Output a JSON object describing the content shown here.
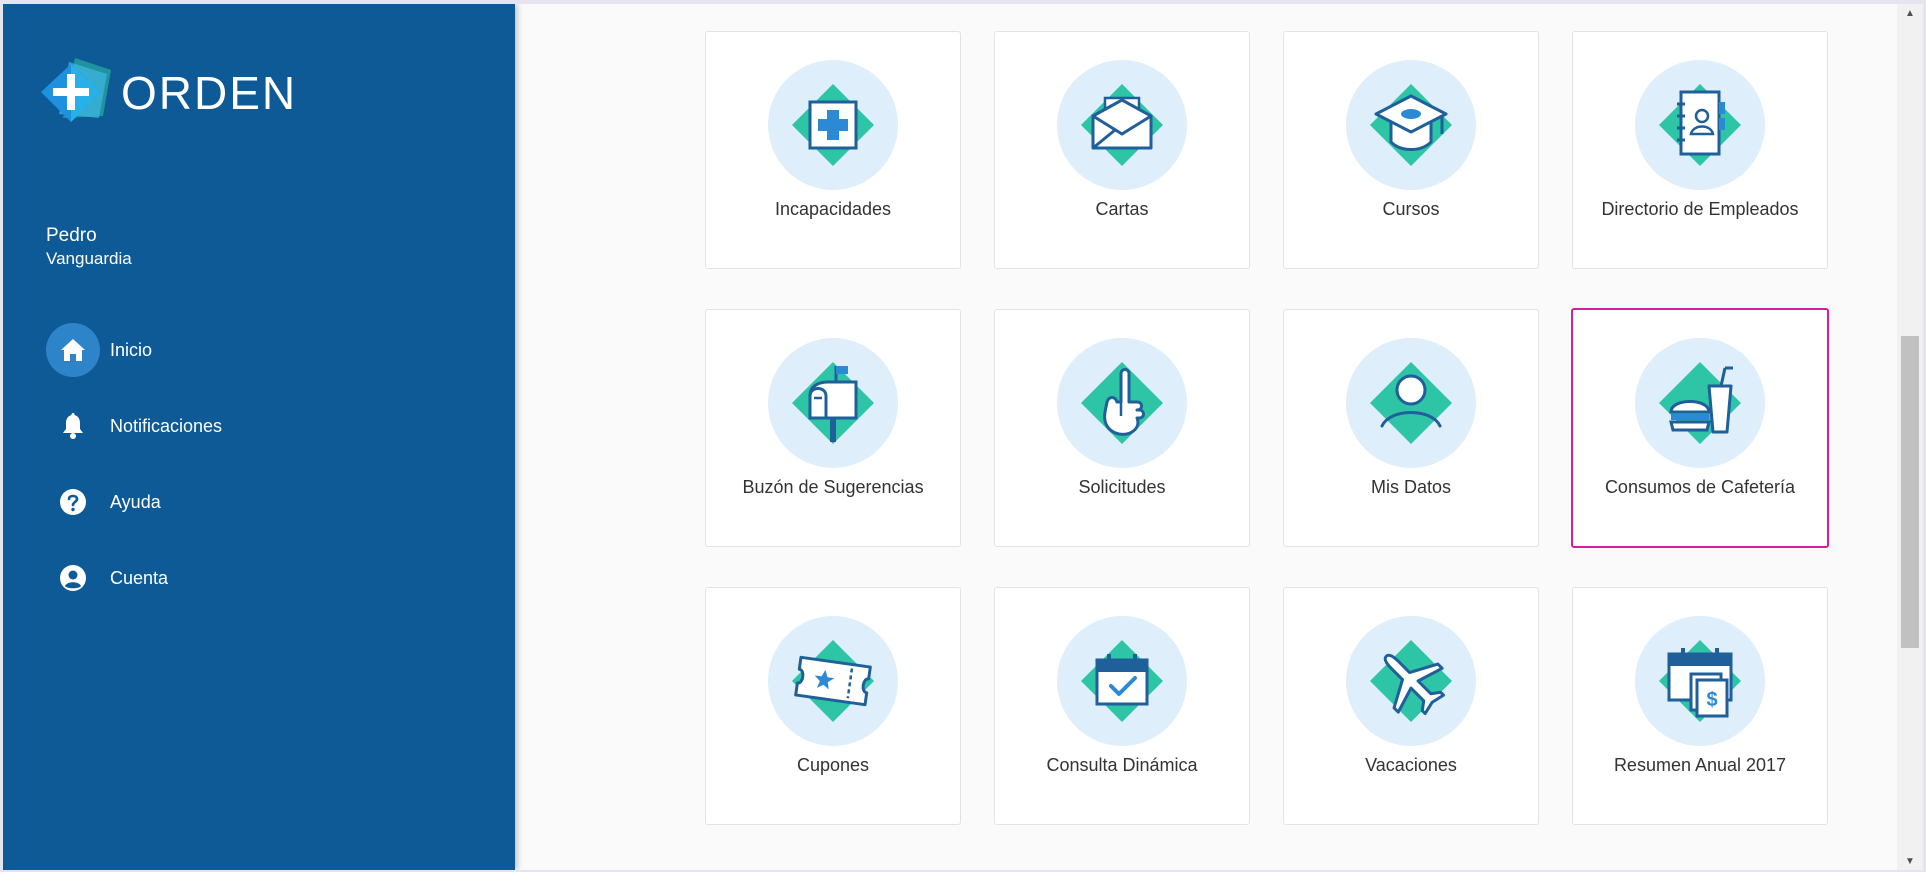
{
  "brand": {
    "name": "ORDEN"
  },
  "user": {
    "first_name": "Pedro",
    "last_name": "Vanguardia"
  },
  "nav": [
    {
      "label": "Inicio",
      "icon": "home-icon",
      "active": true
    },
    {
      "label": "Notificaciones",
      "icon": "bell-icon",
      "active": false
    },
    {
      "label": "Ayuda",
      "icon": "help-icon",
      "active": false
    },
    {
      "label": "Cuenta",
      "icon": "account-icon",
      "active": false
    }
  ],
  "tiles": [
    {
      "label": "Incapacidades",
      "icon": "medical-cross-icon"
    },
    {
      "label": "Cartas",
      "icon": "envelope-icon"
    },
    {
      "label": "Cursos",
      "icon": "graduation-cap-icon"
    },
    {
      "label": "Directorio de Empleados",
      "icon": "address-book-icon"
    },
    {
      "label": "Buzón de Sugerencias",
      "icon": "mailbox-icon"
    },
    {
      "label": "Solicitudes",
      "icon": "raised-hand-icon"
    },
    {
      "label": "Mis Datos",
      "icon": "user-profile-icon"
    },
    {
      "label": "Consumos de Cafetería",
      "icon": "burger-drink-icon",
      "highlighted": true
    },
    {
      "label": "Cupones",
      "icon": "ticket-icon"
    },
    {
      "label": "Consulta Dinámica",
      "icon": "calendar-check-icon"
    },
    {
      "label": "Vacaciones",
      "icon": "airplane-icon"
    },
    {
      "label": "Resumen Anual 2017",
      "icon": "annual-summary-icon"
    }
  ],
  "colors": {
    "sidebar": "#0d5a96",
    "active_nav": "#2e84c8",
    "tile_circle": "#deeefa",
    "diamond": "#2ec4a6",
    "icon_stroke": "#1f5f9a",
    "highlight_border": "#d51e9a"
  }
}
